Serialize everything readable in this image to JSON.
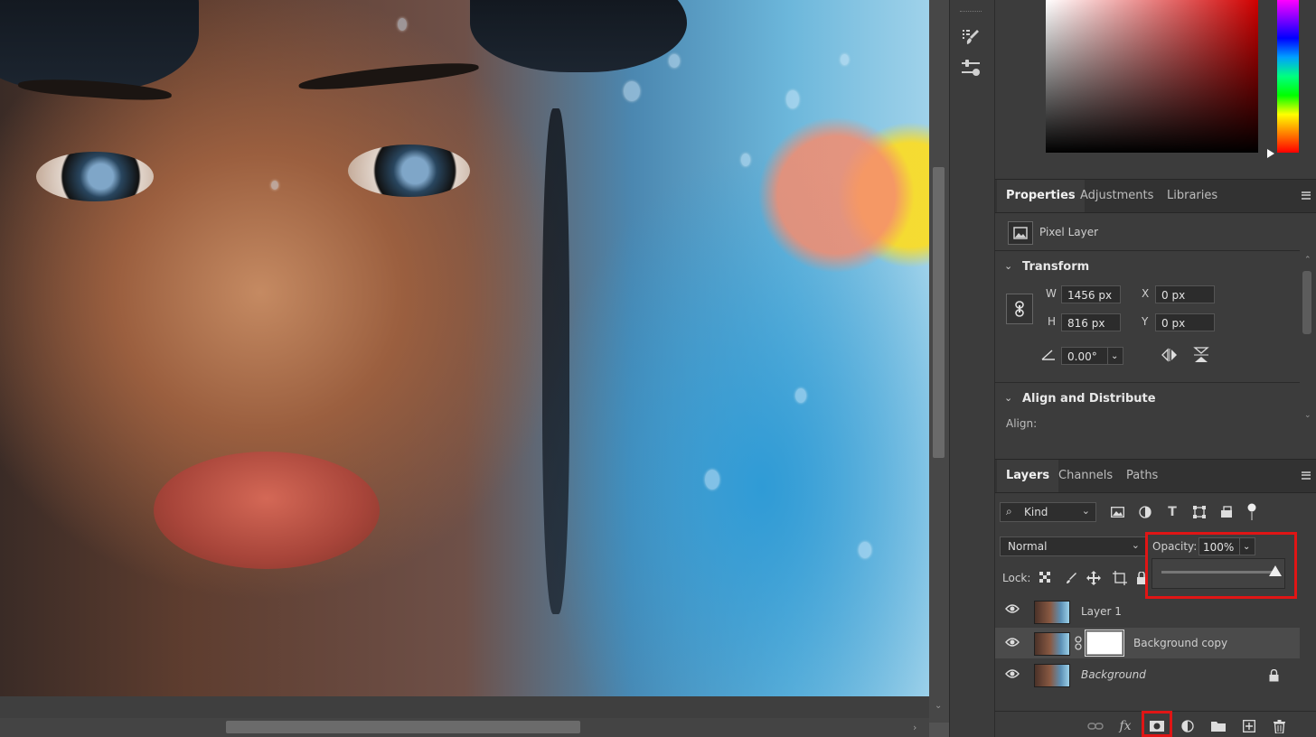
{
  "properties_panel": {
    "tabs": [
      "Properties",
      "Adjustments",
      "Libraries"
    ],
    "layer_type": "Pixel Layer",
    "transform": {
      "title": "Transform",
      "w_label": "W",
      "w_value": "1456 px",
      "h_label": "H",
      "h_value": "816 px",
      "x_label": "X",
      "x_value": "0 px",
      "y_label": "Y",
      "y_value": "0 px",
      "angle_value": "0.00°"
    },
    "align": {
      "title": "Align and Distribute",
      "align_label": "Align:"
    }
  },
  "layers_panel": {
    "tabs": [
      "Layers",
      "Channels",
      "Paths"
    ],
    "filter_kind": "Kind",
    "blend_mode": "Normal",
    "opacity_label": "Opacity:",
    "opacity_value": "100%",
    "opacity_slider_fraction": 1.0,
    "lock_label": "Lock:",
    "layers": [
      {
        "name": "Layer 1",
        "visible": true,
        "selected": false
      },
      {
        "name": "Background copy",
        "visible": true,
        "selected": true,
        "has_mask": true
      },
      {
        "name": "Background",
        "visible": true,
        "selected": false,
        "locked": true
      }
    ]
  },
  "colors": {
    "highlight_box": "#e01515",
    "panel_bg": "#3c3c3c"
  }
}
